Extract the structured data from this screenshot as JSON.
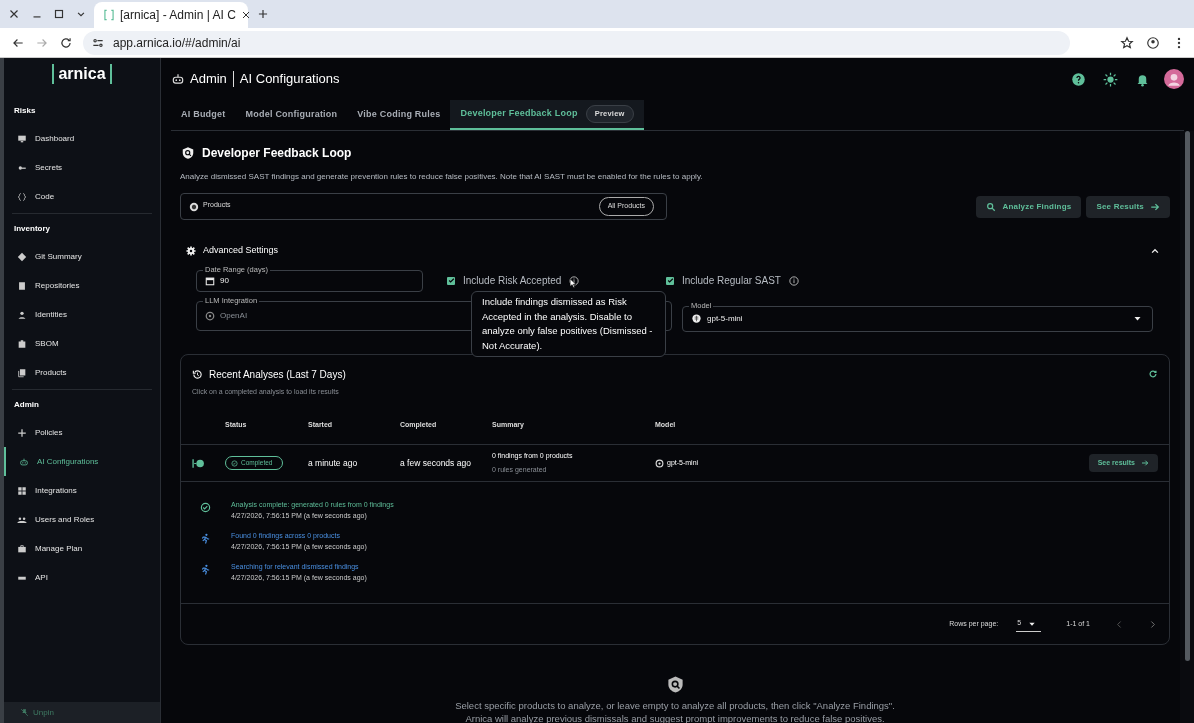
{
  "browser": {
    "tabs": [
      {
        "title": "[arnica] - Admin | AI C",
        "selected": true
      }
    ],
    "url": "app.arnica.io/#/admin/ai"
  },
  "sidebar": {
    "logo": "arnica",
    "sections": [
      {
        "title": "Risks",
        "items": [
          {
            "label": "Dashboard",
            "selected": false
          },
          {
            "label": "Secrets",
            "selected": false
          },
          {
            "label": "Code",
            "selected": false
          }
        ]
      },
      {
        "title": "Inventory",
        "items": [
          {
            "label": "Git Summary",
            "selected": false
          },
          {
            "label": "Repositories",
            "selected": false
          },
          {
            "label": "Identities",
            "selected": false
          },
          {
            "label": "SBOM",
            "selected": false
          },
          {
            "label": "Products",
            "selected": false
          }
        ]
      },
      {
        "title": "Admin",
        "items": [
          {
            "label": "Policies",
            "selected": false
          },
          {
            "label": "AI Configurations",
            "selected": true
          },
          {
            "label": "Integrations",
            "selected": false
          },
          {
            "label": "Users and Roles",
            "selected": false
          },
          {
            "label": "Manage Plan",
            "selected": false
          },
          {
            "label": "API",
            "selected": false
          }
        ]
      }
    ],
    "unpin": "Unpin"
  },
  "header": {
    "section": "Admin",
    "title": "AI Configurations"
  },
  "tabs": [
    {
      "label": "AI Budget",
      "selected": false
    },
    {
      "label": "Model Configuration",
      "selected": false
    },
    {
      "label": "Vibe Coding Rules",
      "selected": false
    },
    {
      "label": "Developer Feedback Loop",
      "selected": true,
      "badge": "Preview"
    }
  ],
  "panel": {
    "title": "Developer Feedback Loop",
    "description": "Analyze dismissed SAST findings and generate prevention rules to reduce false positives. Note that AI SAST must be enabled for the rules to apply.",
    "products": {
      "label": "Products",
      "chip": "All Products"
    },
    "buttons": [
      {
        "label": "Analyze Findings",
        "kind": "search"
      },
      {
        "label": "See Results",
        "kind": "forward"
      }
    ],
    "advanced": {
      "title": "Advanced Settings",
      "expanded": true,
      "date_range": {
        "label": "Date Range (days)",
        "value": "90"
      },
      "include_risk_accepted": {
        "label": "Include Risk Accepted",
        "checked": true
      },
      "include_regular_sast": {
        "label": "Include Regular SAST",
        "checked": true
      },
      "llm_integration": {
        "label": "LLM Integration",
        "value": "OpenAI",
        "disabled": true
      },
      "model": {
        "label": "Model",
        "value": "gpt-5-mini"
      },
      "tooltip": "Include findings dismissed as Risk Accepted in the analysis. Disable to analyze only false positives (Dismissed - Not Accurate)."
    },
    "recent": {
      "title": "Recent Analyses (Last 7 Days)",
      "subtitle": "Click on a completed analysis to load its results",
      "columns": [
        "Status",
        "Started",
        "Completed",
        "Summary",
        "Model"
      ],
      "rows": [
        {
          "status": "Completed",
          "started": "a minute ago",
          "completed": "a few seconds ago",
          "summary": "0 findings from 0 products",
          "summary_detail": "0 rules generated",
          "model": "gpt-5-mini",
          "action": "See results",
          "expanded": true
        }
      ],
      "events": [
        {
          "kind": "success",
          "title": "Analysis complete: generated 0 rules from 0 findings",
          "time": "4/27/2026, 7:56:15 PM (a few seconds ago)"
        },
        {
          "kind": "progress",
          "title": "Found 0 findings across 0 products",
          "time": "4/27/2026, 7:56:15 PM (a few seconds ago)"
        },
        {
          "kind": "progress",
          "title": "Searching for relevant dismissed findings",
          "time": "4/27/2026, 7:56:15 PM (a few seconds ago)"
        }
      ],
      "pagination": {
        "label": "Rows per page:",
        "value": "5",
        "range": "1-1 of 1"
      }
    },
    "empty_state": [
      "Select specific products to analyze, or leave empty to analyze all products, then click \"Analyze Findings\".",
      "Arnica will analyze previous dismissals and suggest prompt improvements to reduce false positives."
    ]
  }
}
